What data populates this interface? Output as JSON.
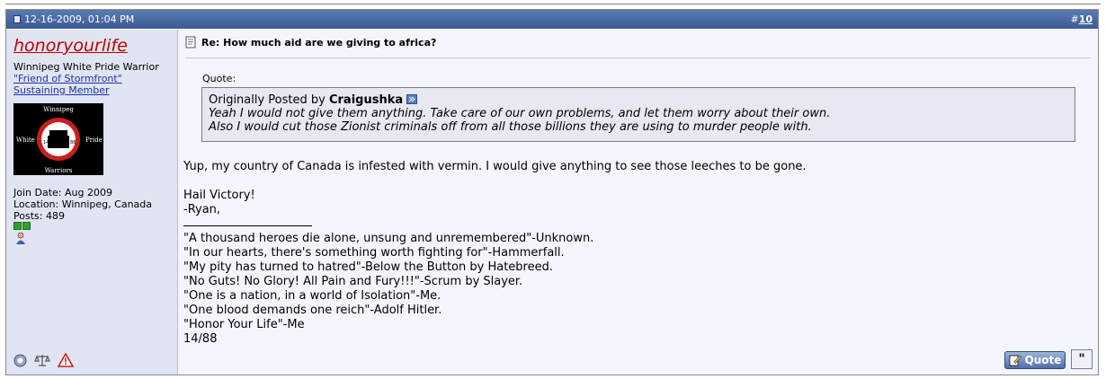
{
  "post": {
    "date": "12-16-2009, 01:04 PM",
    "number_prefix": "#",
    "number": "10",
    "title": "Re: How much aid are we giving to africa?"
  },
  "user": {
    "name": "honoryourlife",
    "rank": "Winnipeg White Pride Warrior",
    "status1": "\"Friend of Stormfront\"",
    "status2": "Sustaining Member",
    "join_date": "Join Date: Aug 2009",
    "location": "Location: Winnipeg, Canada",
    "posts": "Posts: 489",
    "avatar_text": {
      "top": "Winnipeg",
      "left": "White",
      "right": "Pride",
      "bottom": "Warriors",
      "fist_l": "14",
      "fist_r": "88"
    }
  },
  "quote": {
    "label": "Quote:",
    "posted_by_prefix": "Originally Posted by",
    "author": "Craigushka",
    "line1": "Yeah I would not give them anything. Take care of our own problems, and let them worry about their own.",
    "line2": "Also I would cut those Zionist criminals off from all those billions they are using to murder people with."
  },
  "body": {
    "p1": "Yup, my country of Canada is infested with vermin. I would give anything to see those leeches to be gone.",
    "p2a": "Hail Victory!",
    "p2b": "-Ryan,",
    "sig": [
      "\"A thousand heroes die alone, unsung and unremembered\"-Unknown.",
      "\"In our hearts, there's something worth fighting for\"-Hammerfall.",
      "\"My pity has turned to hatred\"-Below the Button by Hatebreed.",
      "\"No Guts! No Glory! All Pain and Fury!!!\"-Scrum by Slayer.",
      "\"One is a nation, in a world of Isolation\"-Me.",
      "\"One blood demands one reich\"-Adolf Hitler.",
      "\"Honor Your Life\"-Me",
      "14/88"
    ]
  },
  "buttons": {
    "quote": "Quote",
    "multiquote": "\""
  },
  "colors": {
    "header_bg": "#4a69a4",
    "sidebar_bg": "#e1e4f2",
    "main_bg": "#f5f5ff",
    "username": "#c00000",
    "link": "#1d33a8"
  }
}
